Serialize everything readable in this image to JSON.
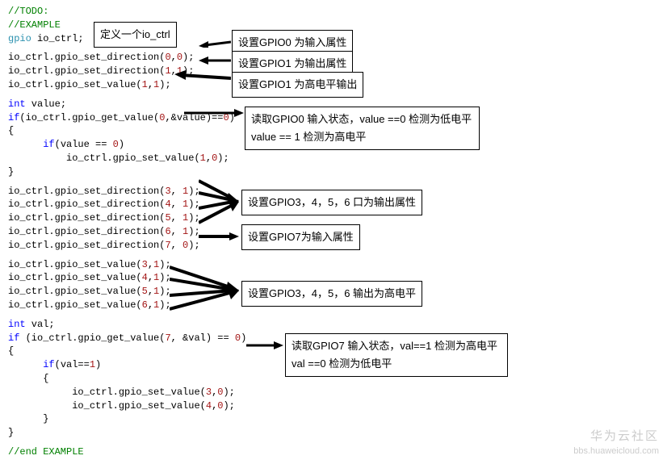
{
  "l1": "//TODO:",
  "l2": "//EXAMPLE",
  "l3": {
    "a": "gpio",
    "b": " io_ctrl;"
  },
  "l4": {
    "a": "io_ctrl.gpio_set_direction(",
    "n1": "0",
    "c": ",",
    "n2": "0",
    "d": ");"
  },
  "l5": {
    "a": "io_ctrl.gpio_set_direction(",
    "n1": "1",
    "c": ",",
    "n2": "1",
    "d": ");"
  },
  "l6": {
    "a": "io_ctrl.gpio_set_value(",
    "n1": "1",
    "c": ",",
    "n2": "1",
    "d": ");"
  },
  "l7": {
    "a": "int",
    "b": " value;"
  },
  "l8": {
    "a": "if",
    "b": "(io_ctrl.gpio_get_value(",
    "n": "0",
    "c": ",&value)==",
    "n2": "0",
    "d": ")"
  },
  "l9": "{",
  "l10": {
    "a": "if",
    "b": "(value == ",
    "n": "0",
    "c": ")"
  },
  "l11": {
    "a": "io_ctrl.gpio_set_value(",
    "n1": "1",
    "c": ",",
    "n2": "0",
    "d": ");"
  },
  "l12": "}",
  "l13": {
    "a": "io_ctrl.gpio_set_direction(",
    "n1": "3",
    "c": ", ",
    "n2": "1",
    "d": ");"
  },
  "l14": {
    "a": "io_ctrl.gpio_set_direction(",
    "n1": "4",
    "c": ", ",
    "n2": "1",
    "d": ");"
  },
  "l15": {
    "a": "io_ctrl.gpio_set_direction(",
    "n1": "5",
    "c": ", ",
    "n2": "1",
    "d": ");"
  },
  "l16": {
    "a": "io_ctrl.gpio_set_direction(",
    "n1": "6",
    "c": ", ",
    "n2": "1",
    "d": ");"
  },
  "l17": {
    "a": "io_ctrl.gpio_set_direction(",
    "n1": "7",
    "c": ", ",
    "n2": "0",
    "d": ");"
  },
  "l18": {
    "a": "io_ctrl.gpio_set_value(",
    "n1": "3",
    "c": ",",
    "n2": "1",
    "d": ");"
  },
  "l19": {
    "a": "io_ctrl.gpio_set_value(",
    "n1": "4",
    "c": ",",
    "n2": "1",
    "d": ");"
  },
  "l20": {
    "a": "io_ctrl.gpio_set_value(",
    "n1": "5",
    "c": ",",
    "n2": "1",
    "d": ");"
  },
  "l21": {
    "a": "io_ctrl.gpio_set_value(",
    "n1": "6",
    "c": ",",
    "n2": "1",
    "d": ");"
  },
  "l22": {
    "a": "int",
    "b": " val;"
  },
  "l23": {
    "a": "if",
    "b": " (io_ctrl.gpio_get_value(",
    "n": "7",
    "c": ", &val) == ",
    "n2": "0",
    "d": ")"
  },
  "l24": "{",
  "l25": {
    "a": "if",
    "b": "(val==",
    "n": "1",
    "c": ")"
  },
  "l26": "{",
  "l27": {
    "a": "io_ctrl.gpio_set_value(",
    "n1": "3",
    "c": ",",
    "n2": "0",
    "d": ");"
  },
  "l28": {
    "a": "io_ctrl.gpio_set_value(",
    "n1": "4",
    "c": ",",
    "n2": "0",
    "d": ");"
  },
  "l29": "}",
  "l30": "}",
  "l31": "//end EXAMPLE",
  "box": {
    "a": "定义一个io_ctrl",
    "b": "设置GPIO0 为输入属性",
    "c": "设置GPIO1 为输出属性",
    "d": "设置GPIO1 为高电平输出",
    "e": "读取GPIO0 输入状态，value ==0 检测为低电平 value == 1 检测为高电平",
    "f": "设置GPIO3，4，5，6 口为输出属性",
    "g": "设置GPIO7为输入属性",
    "h": "设置GPIO3，4，5，6 输出为高电平",
    "i": "读取GPIO7 输入状态，val==1 检测为高电平  val ==0 检测为低电平"
  },
  "wm1": "华为云社区",
  "wm2": "bbs.huaweicloud.com"
}
